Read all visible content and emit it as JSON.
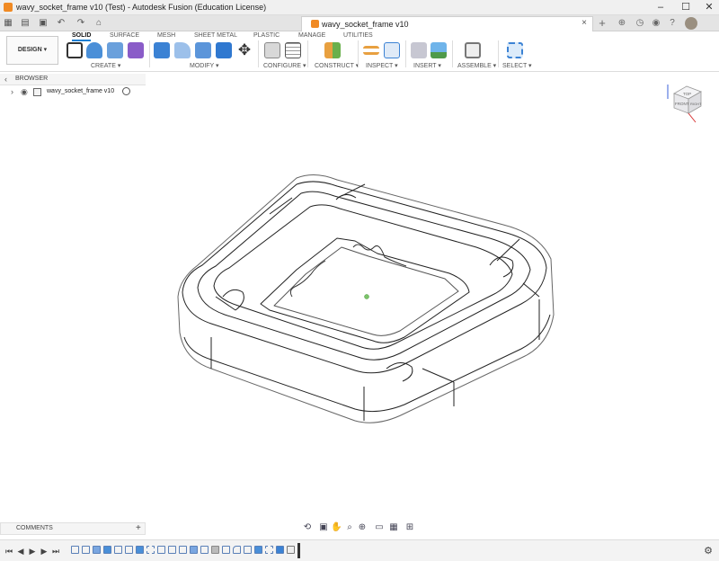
{
  "window": {
    "title": "wavy_socket_frame v10 (Test) - Autodesk Fusion (Education License)",
    "minimize": "–",
    "maximize": "☐",
    "close": "✕"
  },
  "document_tab": {
    "label": "wavy_socket_frame v10",
    "close": "×"
  },
  "ribbon": {
    "workspace": "DESIGN ▾",
    "tabs": [
      "SOLID",
      "SURFACE",
      "MESH",
      "SHEET METAL",
      "PLASTIC",
      "MANAGE",
      "UTILITIES"
    ],
    "active_tab": "SOLID",
    "groups": [
      "CREATE ▾",
      "MODIFY ▾",
      "CONFIGURE ▾",
      "CONSTRUCT ▾",
      "INSPECT ▾",
      "INSERT ▾",
      "ASSEMBLE ▾",
      "SELECT ▾"
    ]
  },
  "browser": {
    "header": "BROWSER",
    "root_item": "wavy_socket_frame v10"
  },
  "viewcube": {
    "top": "TOP",
    "front": "FRONT",
    "right": "RIGHT"
  },
  "comments": {
    "label": "COMMENTS",
    "add": "+"
  },
  "colors": {
    "accent": "#1a7fd3",
    "app_orange": "#f08a24"
  }
}
